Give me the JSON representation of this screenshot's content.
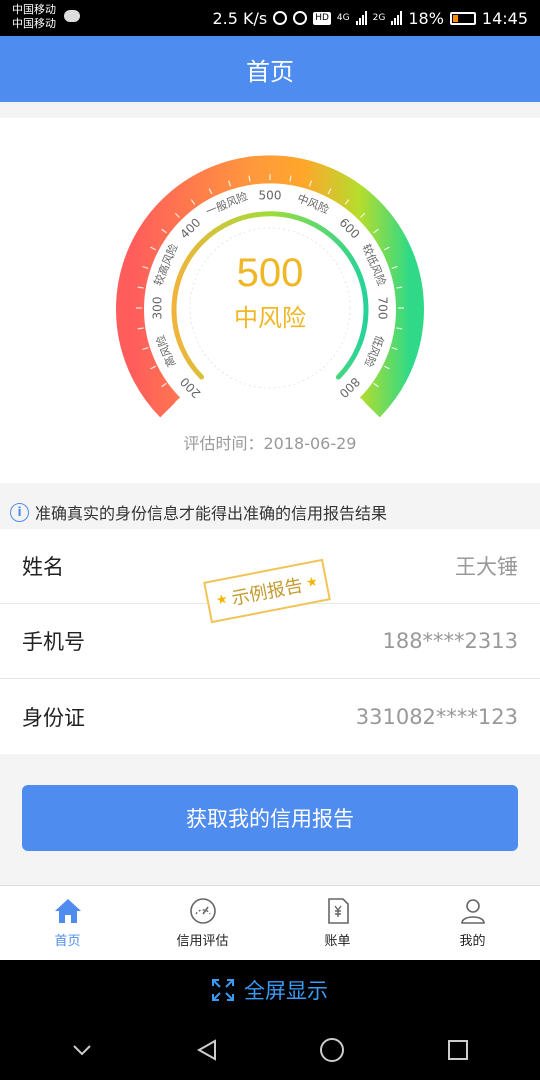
{
  "status_bar": {
    "carrier_1": "中国移动",
    "carrier_2": "中国移动",
    "speed": "2.5 K/s",
    "hd": "HD",
    "net_4g": "4G",
    "net_2g": "2G",
    "battery": "18%",
    "time": "14:45"
  },
  "header": {
    "title": "首页"
  },
  "gauge": {
    "score": "500",
    "level": "中风险",
    "tick_labels": [
      "200",
      "高风险",
      "300",
      "较高风险",
      "400",
      "一般风险",
      "500",
      "中风险",
      "600",
      "较低风险",
      "700",
      "低风险",
      "800"
    ],
    "eval_time": "评估时间：2018-06-29",
    "score_color": "#f0b624",
    "outer_colors": [
      "#ff5c5c",
      "#ffa62b",
      "#b6dd2d",
      "#2fd987"
    ]
  },
  "notice": {
    "text": "准确真实的身份信息才能得出准确的信用报告结果"
  },
  "rows": [
    {
      "label": "姓名",
      "value": "王大锤"
    },
    {
      "label": "手机号",
      "value": "188****2313"
    },
    {
      "label": "身份证",
      "value": "331082****123"
    }
  ],
  "stamp": {
    "text": "示例报告"
  },
  "main_button": {
    "label": "获取我的信用报告"
  },
  "tabs": [
    {
      "label": "首页",
      "icon": "home-icon"
    },
    {
      "label": "信用评估",
      "icon": "gauge-icon"
    },
    {
      "label": "账单",
      "icon": "bill-icon"
    },
    {
      "label": "我的",
      "icon": "user-icon"
    }
  ],
  "fullscreen": {
    "label": "全屏显示"
  },
  "colors": {
    "primary": "#4f8cf0",
    "fullscreen_text": "#3a9bf4"
  }
}
